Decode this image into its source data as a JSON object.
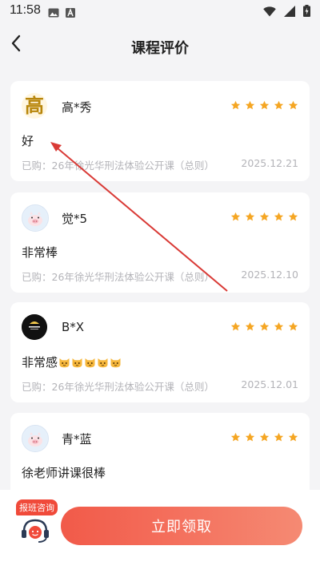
{
  "status_bar": {
    "time": "11:58",
    "left_icons": [
      "image-icon",
      "app-a-icon"
    ],
    "right_icons": [
      "wifi-icon",
      "signal-icon",
      "battery-charging-icon"
    ]
  },
  "header": {
    "back_icon": "back-arrow-icon",
    "title": "课程评价"
  },
  "colors": {
    "star": "#f5a623",
    "cta_start": "#f15a49",
    "cta_end": "#f58a73",
    "annotation_arrow": "#d93a36"
  },
  "reviews": [
    {
      "username": "高*秀",
      "avatar": "character-gao-avatar",
      "avatar_glyph": "高",
      "rating": 5,
      "text": "好",
      "emoji_count": 0,
      "purchased": "已购：26年徐光华刑法体验公开课（总则）",
      "date": "2025.12.21"
    },
    {
      "username": "觉*5",
      "avatar": "piggy-avatar",
      "rating": 5,
      "text": "非常棒",
      "emoji_count": 0,
      "purchased": "已购：26年徐光华刑法体验公开课（总则）",
      "date": "2025.12.10"
    },
    {
      "username": "B*X",
      "avatar": "dark-logo-avatar",
      "rating": 5,
      "text": "非常感",
      "emoji_count": 5,
      "emoji_name": "cat-face-emoji",
      "purchased": "已购：26年徐光华刑法体验公开课（总则）",
      "date": "2025.12.01"
    },
    {
      "username": "青*蓝",
      "avatar": "piggy-avatar",
      "rating": 5,
      "text": "徐老师讲课很棒",
      "emoji_count": 0,
      "purchased": "",
      "date": ""
    }
  ],
  "bottom_bar": {
    "consult_tag": "报班咨询",
    "consult_icon": "headset-service-icon",
    "cta_label": "立即领取"
  }
}
